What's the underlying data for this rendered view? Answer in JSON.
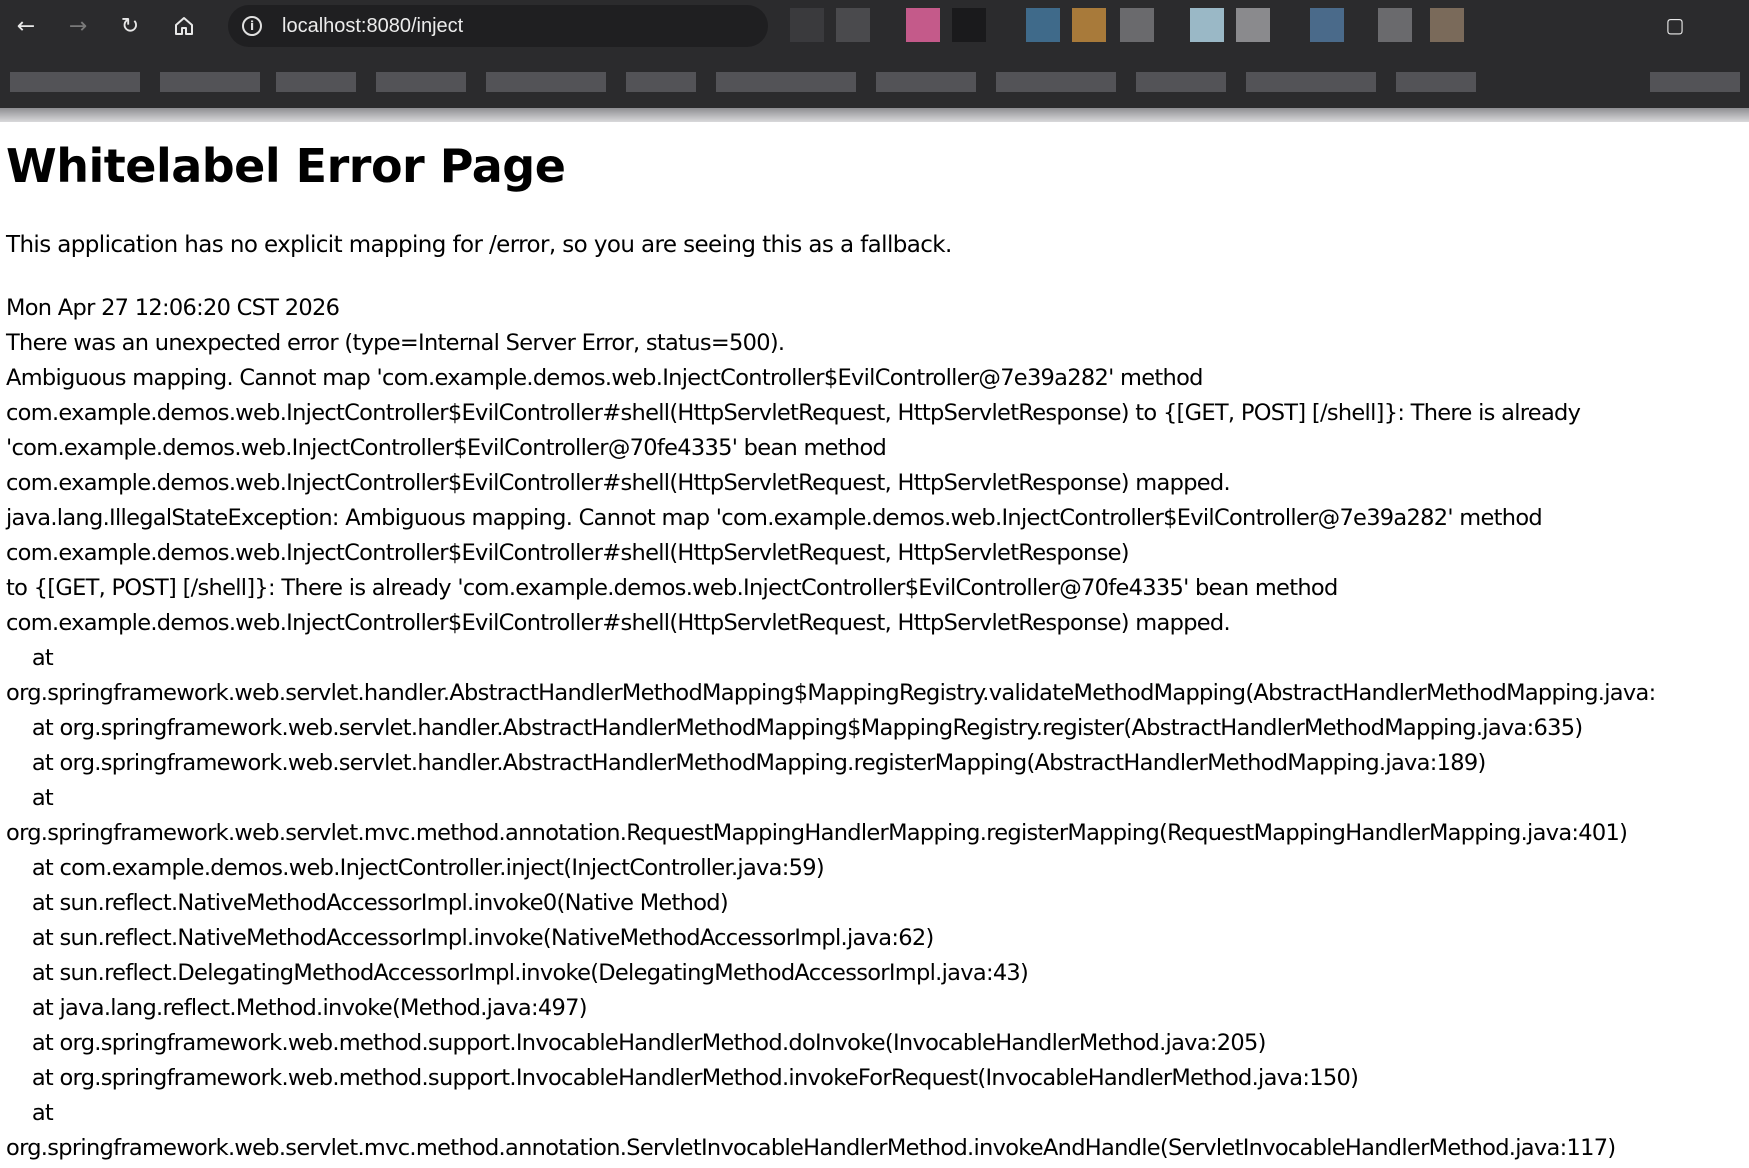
{
  "browser": {
    "back_icon": "back-arrow-icon",
    "forward_icon": "forward-arrow-icon",
    "reload_icon": "reload-icon",
    "home_icon": "home-icon",
    "site_info_icon": "info-icon",
    "url": "localhost:8080/inject",
    "maximize_icon": "maximize-icon",
    "extension_colors": [
      "#3a3a3d",
      "#4a4a4d",
      "#c45a8a",
      "#1a1a1c",
      "#3f6a8a",
      "#a87a3a",
      "#6a6a6d",
      "#9ab8c6",
      "#8a8a8d",
      "#4a6a8a",
      "#6a6a6d",
      "#7a6a5a"
    ]
  },
  "page": {
    "title": "Whitelabel Error Page",
    "description": "This application has no explicit mapping for /error, so you are seeing this as a fallback.",
    "error_lines": [
      "Mon Apr 27 12:06:20 CST 2026",
      "There was an unexpected error (type=Internal Server Error, status=500).",
      "Ambiguous mapping. Cannot map 'com.example.demos.web.InjectController$EvilController@7e39a282' method",
      "com.example.demos.web.InjectController$EvilController#shell(HttpServletRequest, HttpServletResponse) to {[GET, POST] [/shell]}: There is already",
      "'com.example.demos.web.InjectController$EvilController@70fe4335' bean method",
      "com.example.demos.web.InjectController$EvilController#shell(HttpServletRequest, HttpServletResponse) mapped.",
      "java.lang.IllegalStateException: Ambiguous mapping. Cannot map 'com.example.demos.web.InjectController$EvilController@7e39a282' method",
      "com.example.demos.web.InjectController$EvilController#shell(HttpServletRequest, HttpServletResponse)",
      "to {[GET, POST] [/shell]}: There is already 'com.example.demos.web.InjectController$EvilController@70fe4335' bean method",
      "com.example.demos.web.InjectController$EvilController#shell(HttpServletRequest, HttpServletResponse) mapped.",
      "\tat",
      "org.springframework.web.servlet.handler.AbstractHandlerMethodMapping$MappingRegistry.validateMethodMapping(AbstractHandlerMethodMapping.java:",
      "\tat org.springframework.web.servlet.handler.AbstractHandlerMethodMapping$MappingRegistry.register(AbstractHandlerMethodMapping.java:635)",
      "\tat org.springframework.web.servlet.handler.AbstractHandlerMethodMapping.registerMapping(AbstractHandlerMethodMapping.java:189)",
      "\tat",
      "org.springframework.web.servlet.mvc.method.annotation.RequestMappingHandlerMapping.registerMapping(RequestMappingHandlerMapping.java:401)",
      "\tat com.example.demos.web.InjectController.inject(InjectController.java:59)",
      "\tat sun.reflect.NativeMethodAccessorImpl.invoke0(Native Method)",
      "\tat sun.reflect.NativeMethodAccessorImpl.invoke(NativeMethodAccessorImpl.java:62)",
      "\tat sun.reflect.DelegatingMethodAccessorImpl.invoke(DelegatingMethodAccessorImpl.java:43)",
      "\tat java.lang.reflect.Method.invoke(Method.java:497)",
      "\tat org.springframework.web.method.support.InvocableHandlerMethod.doInvoke(InvocableHandlerMethod.java:205)",
      "\tat org.springframework.web.method.support.InvocableHandlerMethod.invokeForRequest(InvocableHandlerMethod.java:150)",
      "\tat",
      "org.springframework.web.servlet.mvc.method.annotation.ServletInvocableHandlerMethod.invokeAndHandle(ServletInvocableHandlerMethod.java:117)"
    ]
  }
}
